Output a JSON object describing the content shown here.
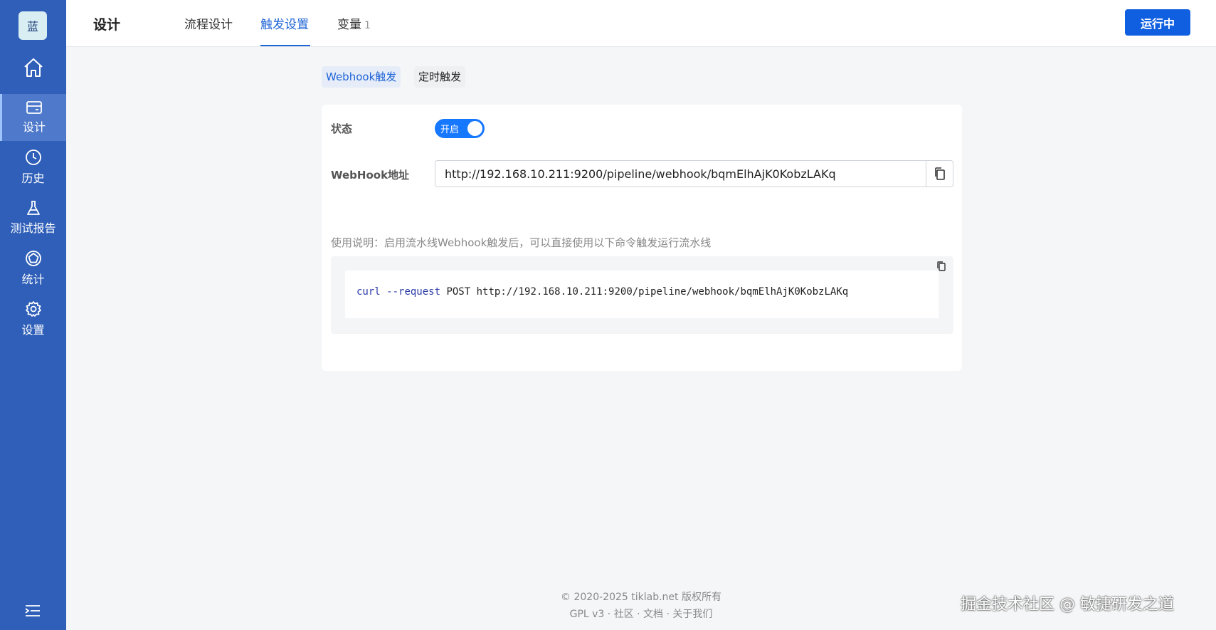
{
  "sidebar": {
    "logo_text": "蓝",
    "items": [
      {
        "label": "设计",
        "icon": "design-icon"
      },
      {
        "label": "历史",
        "icon": "clock-icon"
      },
      {
        "label": "测试报告",
        "icon": "flask-icon"
      },
      {
        "label": "统计",
        "icon": "pentagon-icon"
      },
      {
        "label": "设置",
        "icon": "gear-icon"
      }
    ],
    "active_index": 0
  },
  "header": {
    "title": "设计",
    "tabs": [
      {
        "label": "流程设计"
      },
      {
        "label": "触发设置"
      },
      {
        "label": "变量",
        "count": "1"
      }
    ],
    "active_tab": 1,
    "run_button": "运行中"
  },
  "trigger": {
    "subtabs": [
      "Webhook触发",
      "定时触发"
    ],
    "active_subtab": 0,
    "status_label": "状态",
    "toggle_label": "开启",
    "toggle_on": true,
    "webhook_label": "WebHook地址",
    "webhook_url": "http://192.168.10.211:9200/pipeline/webhook/bqmElhAjK0KobzLAKq",
    "usage_text": "使用说明：启用流水线Webhook触发后，可以直接使用以下命令触发运行流水线",
    "command": {
      "cmd": "curl",
      "flag": "--request",
      "method": "POST",
      "url": "http://192.168.10.211:9200/pipeline/webhook/bqmElhAjK0KobzLAKq"
    }
  },
  "footer": {
    "copyright": "© 2020-2025 tiklab.net 版权所有",
    "links": [
      "GPL v3",
      "社区",
      "文档",
      "关于我们"
    ],
    "separator": "·"
  },
  "watermark": "掘金技术社区 @ 敏捷研发之道",
  "colors": {
    "sidebar_bg": "#2f5fb8",
    "accent": "#1f64d6",
    "run_button": "#0f5fe0",
    "toggle_on": "#1677ff"
  }
}
